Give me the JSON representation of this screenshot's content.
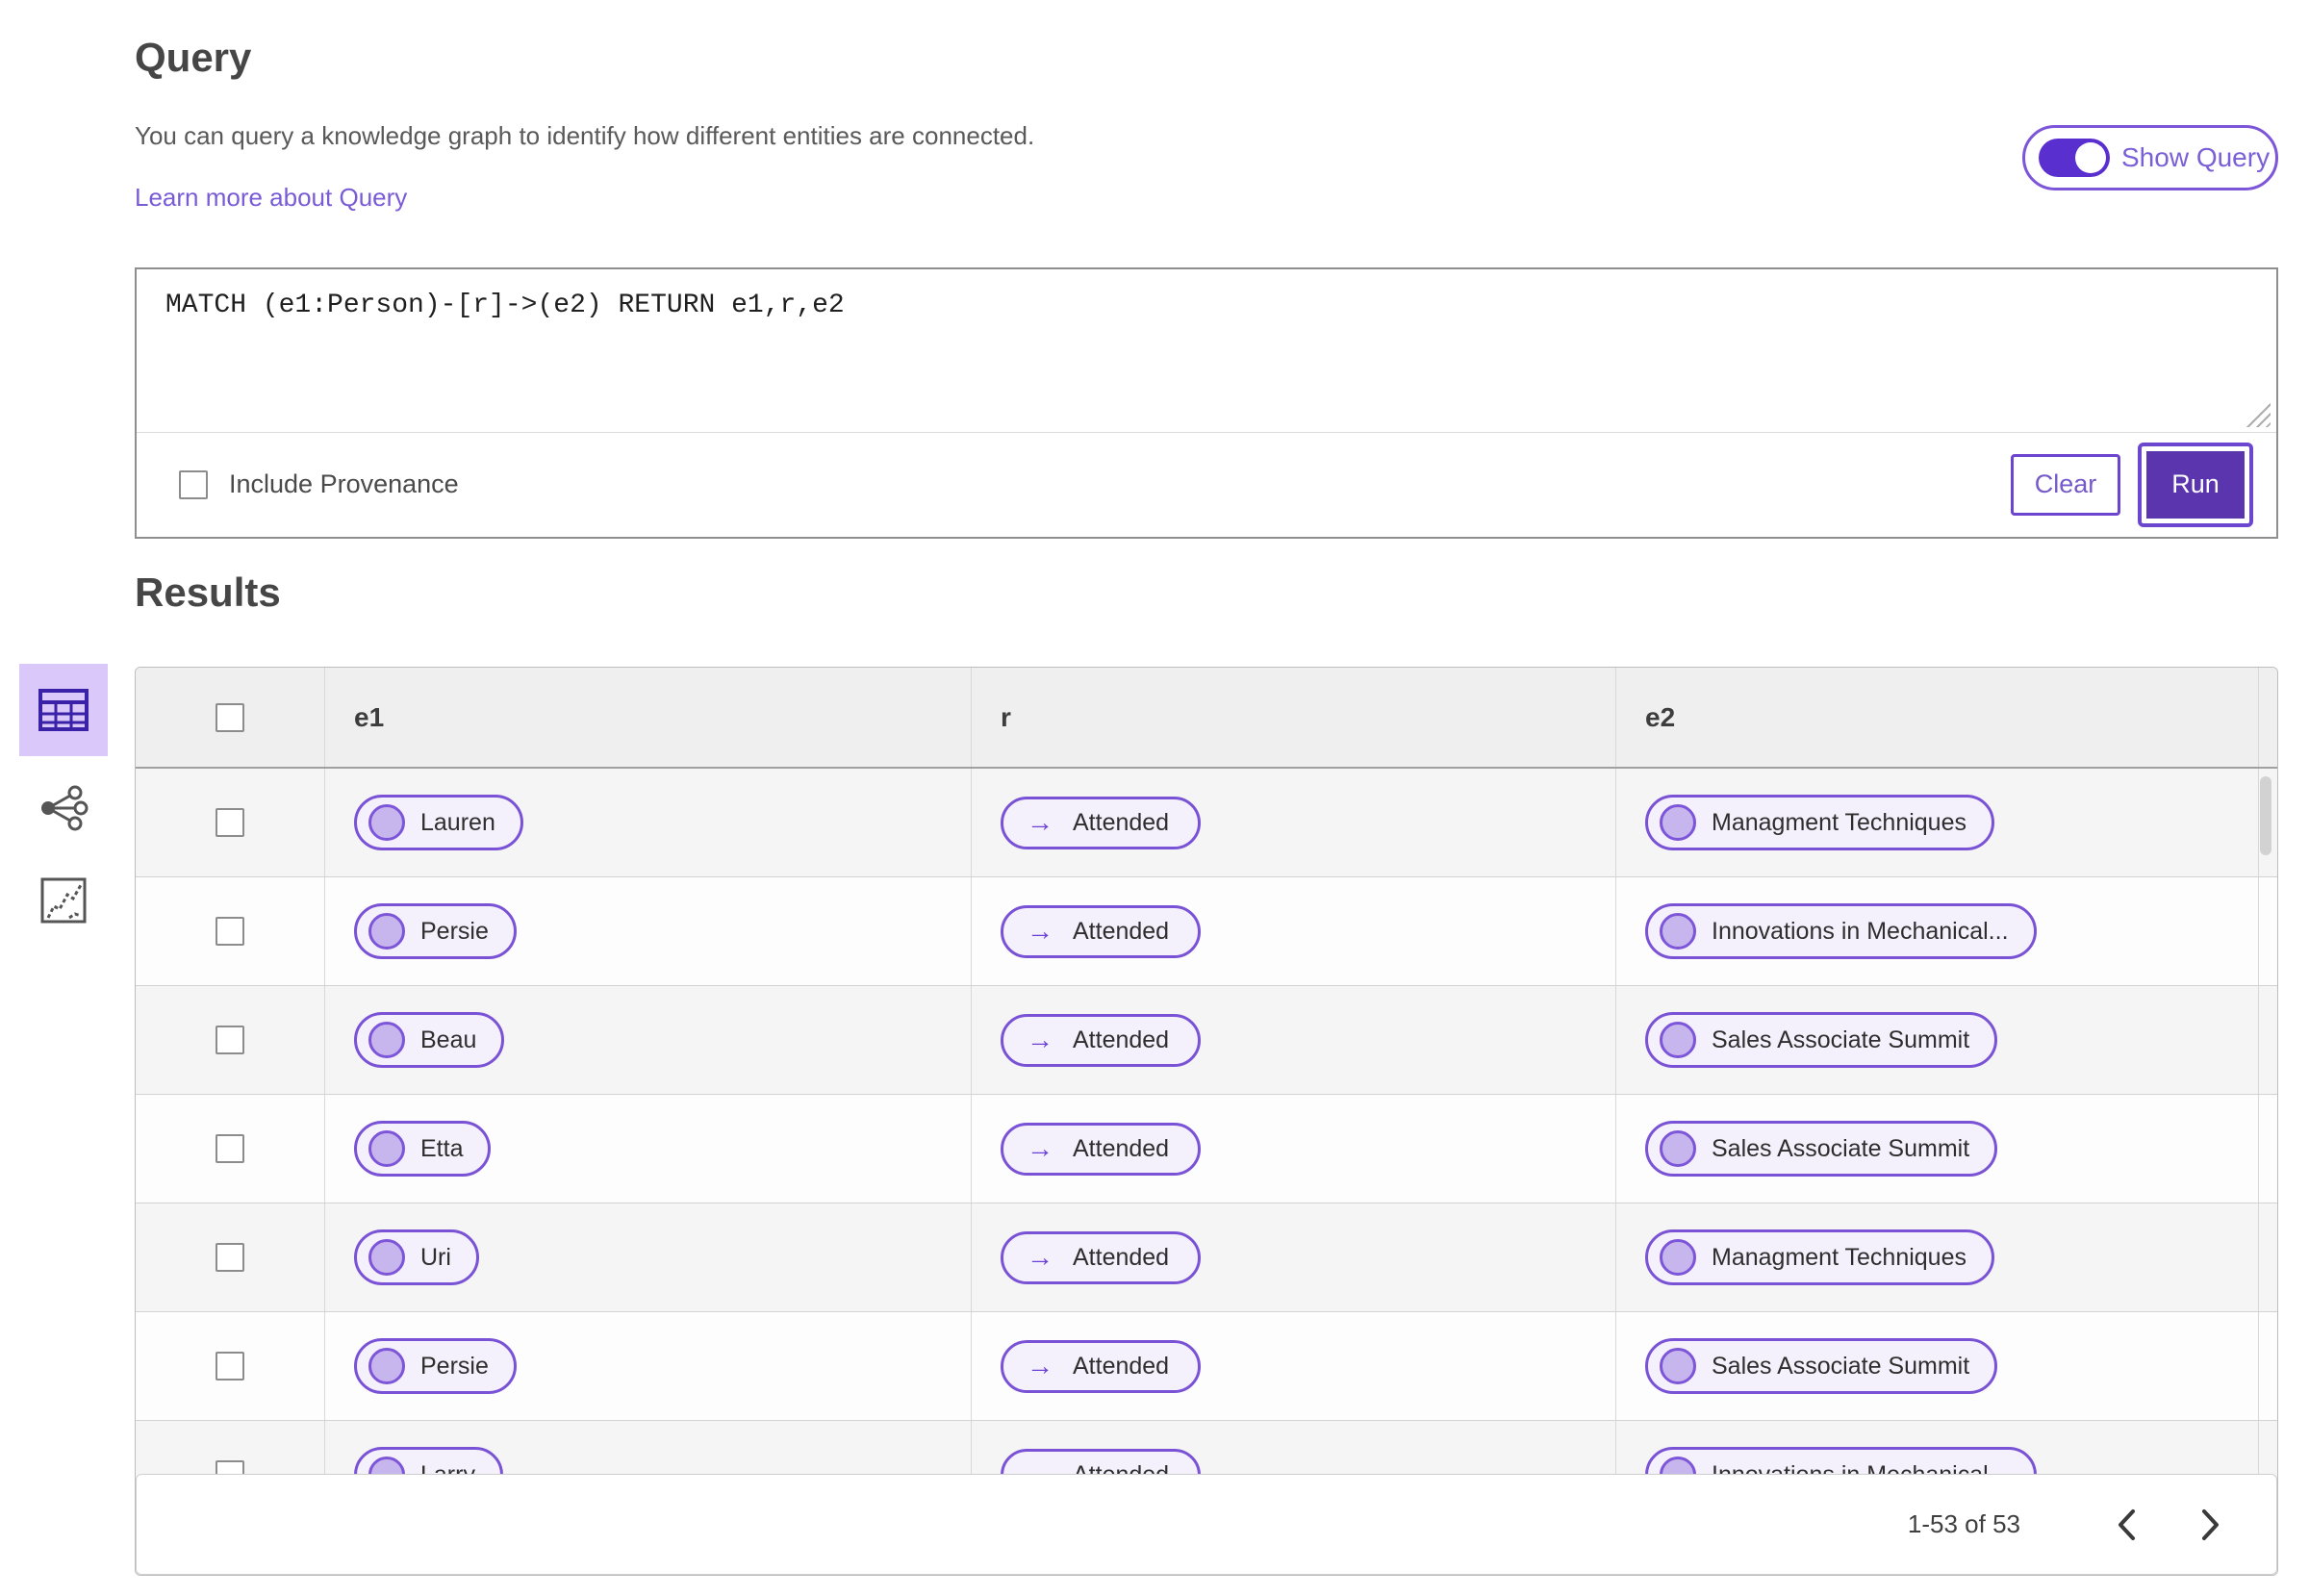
{
  "query_section": {
    "title": "Query",
    "description": "You can query a knowledge graph to identify how different entities are connected.",
    "link_label": "Learn more about Query",
    "show_query_label": "Show Query",
    "show_query_state": "on",
    "query_text": "MATCH (e1:Person)-[r]->(e2) RETURN e1,r,e2",
    "include_provenance_label": "Include Provenance",
    "include_provenance_checked": false,
    "clear_label": "Clear",
    "run_label": "Run"
  },
  "results_section": {
    "title": "Results",
    "view_switcher": {
      "selected": "table",
      "views": [
        "table",
        "network",
        "chart"
      ]
    },
    "table": {
      "columns": [
        "e1",
        "r",
        "e2"
      ],
      "rows": [
        {
          "e1": "Lauren",
          "r": "Attended",
          "e2": "Managment Techniques"
        },
        {
          "e1": "Persie",
          "r": "Attended",
          "e2": "Innovations in Mechanical..."
        },
        {
          "e1": "Beau",
          "r": "Attended",
          "e2": "Sales Associate Summit"
        },
        {
          "e1": "Etta",
          "r": "Attended",
          "e2": "Sales Associate Summit"
        },
        {
          "e1": "Uri",
          "r": "Attended",
          "e2": "Managment Techniques"
        },
        {
          "e1": "Persie",
          "r": "Attended",
          "e2": "Sales Associate Summit"
        },
        {
          "e1": "Larry",
          "r": "Attended",
          "e2": "Innovations in Mechanical..."
        }
      ],
      "relation_arrow": "→"
    },
    "pagination": {
      "range_text": "1-53 of 53"
    }
  },
  "colors": {
    "accent_purple": "#7a52d6",
    "deep_purple": "#5a35ad",
    "toggle_track": "#5a2fd0",
    "link_purple": "#7a5bd6",
    "pill_background": "#f4f1fc",
    "pill_dot": "#c7b6ee",
    "selected_view_background": "#d9c8f9",
    "table_header_background": "#efeff0",
    "row_alt_background": "#f5f5f5"
  }
}
